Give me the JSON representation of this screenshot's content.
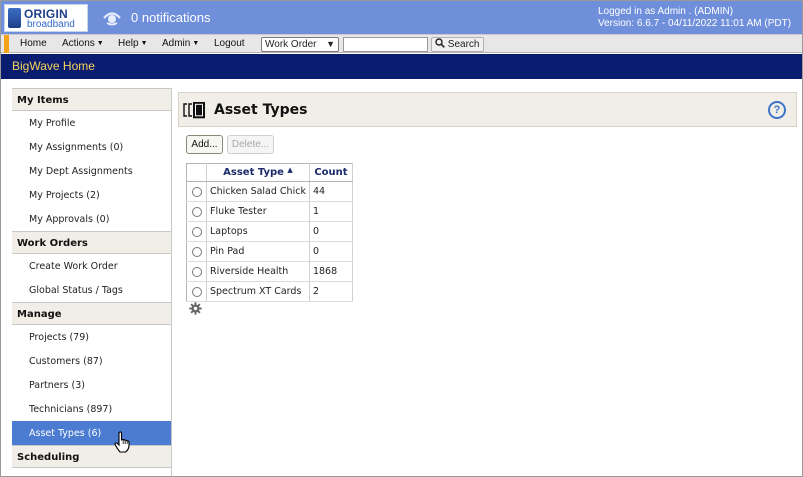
{
  "header": {
    "logo_line1": "ORIGIN",
    "logo_line2": "broadband",
    "notifications": "0 notifications",
    "logged_in": "Logged in as Admin . (ADMIN)",
    "version": "Version: 6.6.7 - 04/11/2022 11:01 AM (PDT)"
  },
  "menu": {
    "home": "Home",
    "actions": "Actions",
    "help": "Help",
    "admin": "Admin",
    "logout": "Logout",
    "search_type": "Work Order",
    "search_value": "",
    "search_button": "Search"
  },
  "title_bar": "BigWave Home",
  "sidebar": {
    "my_items": {
      "heading": "My Items",
      "items": [
        "My Profile",
        "My Assignments (0)",
        "My Dept Assignments",
        "My Projects (2)",
        "My Approvals (0)"
      ]
    },
    "work_orders": {
      "heading": "Work Orders",
      "items": [
        "Create Work Order",
        "Global Status / Tags"
      ]
    },
    "manage": {
      "heading": "Manage",
      "items": [
        "Projects (79)",
        "Customers (87)",
        "Partners (3)",
        "Technicians (897)",
        "Asset Types (6)"
      ]
    },
    "scheduling": {
      "heading": "Scheduling"
    }
  },
  "main": {
    "title": "Asset Types",
    "help_glyph": "?",
    "add_button": "Add...",
    "delete_button": "Delete...",
    "columns": {
      "asset_type": "Asset Type",
      "count": "Count"
    },
    "rows": [
      {
        "name": "Chicken Salad Chick",
        "count": "44"
      },
      {
        "name": "Fluke Tester",
        "count": "1"
      },
      {
        "name": "Laptops",
        "count": "0"
      },
      {
        "name": "Pin Pad",
        "count": "0"
      },
      {
        "name": "Riverside Health",
        "count": "1868"
      },
      {
        "name": "Spectrum XT Cards",
        "count": "2"
      }
    ]
  },
  "colors": {
    "top_banner": "#6f8fdb",
    "title_bar": "#0a1c70",
    "title_text": "#f4d45a",
    "menu_accent": "#f5a21b",
    "sidebar_active": "#4b7cd2",
    "help_icon": "#3f75c9"
  },
  "icons": {
    "notifications": "notification-bell-icon",
    "help": "help-icon",
    "grid_settings": "gear-icon",
    "page": "asset-types-icon",
    "cursor": "hand-pointer-icon"
  }
}
